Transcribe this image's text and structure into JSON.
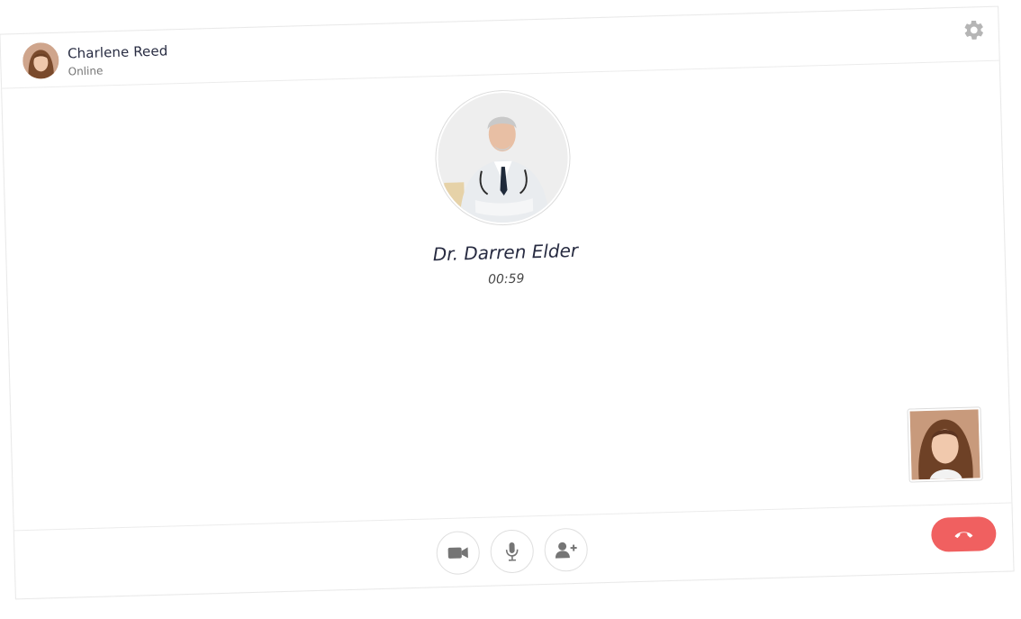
{
  "header": {
    "user_name": "Charlene Reed",
    "user_status": "Online",
    "settings_icon": "gear-icon"
  },
  "call": {
    "doctor_name": "Dr. Darren Elder",
    "timer": "00:59"
  },
  "controls": {
    "video_icon": "video-camera-icon",
    "mic_icon": "microphone-icon",
    "add_user_icon": "user-plus-icon",
    "end_call_icon": "phone-hangup-icon"
  },
  "colors": {
    "end_call": "#f06060",
    "text_primary": "#272b41",
    "icon_gray": "#757575"
  }
}
